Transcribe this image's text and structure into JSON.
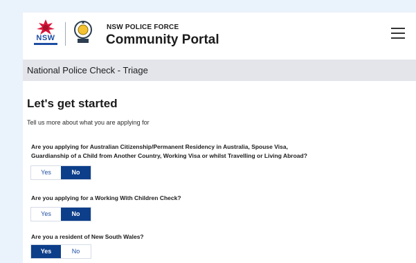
{
  "header": {
    "nsw_logo_text": "NSW",
    "brand_top": "NSW POLICE FORCE",
    "brand_main": "Community Portal",
    "menu_icon": "hamburger-menu-icon"
  },
  "subheader": {
    "title": "National Police Check - Triage"
  },
  "main": {
    "heading": "Let's get started",
    "intro": "Tell us more about what you are applying for",
    "questions": [
      {
        "line1": "Are you applying for Australian Citizenship/Permanent Residency in Australia, Spouse Visa,",
        "line2": "Guardianship of a Child from Another Country, Working Visa or whilst Travelling or Living Abroad?",
        "yes": "Yes",
        "no": "No",
        "selected": "No"
      },
      {
        "line1": "Are you applying for a Working With Children Check?",
        "yes": "Yes",
        "no": "No",
        "selected": "No"
      },
      {
        "line1": "Are you a resident of New South Wales?",
        "yes": "Yes",
        "no": "No",
        "selected": "Yes"
      }
    ]
  },
  "colors": {
    "selected": "#0d3e8a",
    "accent": "#1d4ea2",
    "page_bg": "#eaf2fb",
    "subheader_bg": "#e3e5ea"
  }
}
